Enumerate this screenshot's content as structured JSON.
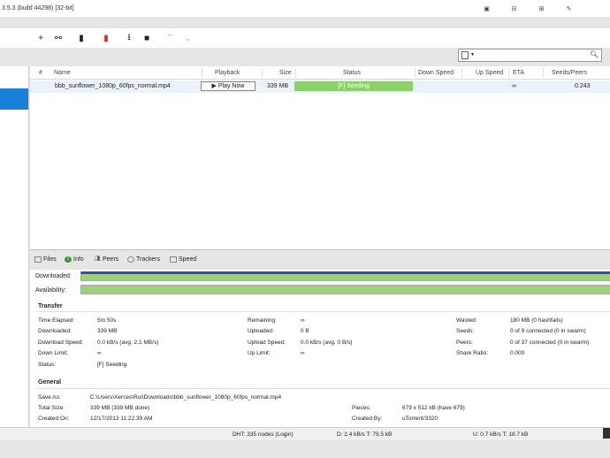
{
  "window": {
    "title": "3.5.3  (build 44298) [32-bit]"
  },
  "toolbar": {
    "add": "+",
    "add_link": "⚯",
    "create": "▮",
    "remove": "▮",
    "download": "⭳",
    "stop": "■",
    "up": "⌃",
    "down": "⌄"
  },
  "search": {
    "placeholder": "",
    "dropdown": "▾",
    "icon": "search-icon"
  },
  "columns": {
    "num": "#",
    "name": "Name",
    "playback": "Playback",
    "size": "Size",
    "status": "Status",
    "down_speed": "Down Speed",
    "up_speed": "Up Speed",
    "eta": "ETA",
    "seeds_peers": "Seeds/Peers"
  },
  "torrents": [
    {
      "name": "bbb_sunflower_1080p_60fps_normal.mp4",
      "playback": "▶ Play Now",
      "size": "339 MB",
      "status": "[F] Seeding",
      "eta": "∞",
      "seeds_peers": "0.243"
    }
  ],
  "tabs": [
    "Files",
    "Info",
    "Peers",
    "Trackers",
    "Speed"
  ],
  "bars": {
    "downloaded": "Downloaded:",
    "availability": "Availability:"
  },
  "transfer": {
    "heading": "Transfer",
    "col1": [
      {
        "label": "Time Elapsed:",
        "value": "5m 50s"
      },
      {
        "label": "Downloaded:",
        "value": "339 MB"
      },
      {
        "label": "Download Speed:",
        "value": "0.0 kB/s (avg. 2.1 MB/s)"
      },
      {
        "label": "Down Limit:",
        "value": "∞"
      },
      {
        "label": "Status:",
        "value": "[F] Seeding"
      }
    ],
    "col2": [
      {
        "label": "Remaining:",
        "value": "∞"
      },
      {
        "label": "Uploaded:",
        "value": "0 B"
      },
      {
        "label": "Upload Speed:",
        "value": "0.0 kB/s (avg. 0 B/s)"
      },
      {
        "label": "Up Limit:",
        "value": "∞"
      }
    ],
    "col3": [
      {
        "label": "Wasted:",
        "value": "180 MB (0 hashfails)"
      },
      {
        "label": "Seeds:",
        "value": "0 of 9 connected (0 in swarm)"
      },
      {
        "label": "Peers:",
        "value": "0 of 37 connected (0 in swarm)"
      },
      {
        "label": "Share Ratio:",
        "value": "0.000"
      }
    ]
  },
  "general": {
    "heading": "General",
    "save_as": {
      "label": "Save As:",
      "value": "C:\\Users\\Xerces\\Rui\\Downloads\\bbb_sunflower_1080p_60fps_normal.mp4"
    },
    "total_size": {
      "label": "Total Size:",
      "value": "339 MB (339 MB done)"
    },
    "created_on": {
      "label": "Created On:",
      "value": "12/17/2013 11:22:39 AM"
    },
    "pieces": {
      "label": "Pieces:",
      "value": "679 x 512 kB (have 679)"
    },
    "created_by": {
      "label": "Created By:",
      "value": "uTorrent/3320"
    }
  },
  "statusbar": {
    "dht": "DHT: 335 nodes (Login)",
    "download": "D: 2.4 kB/s T: 79.5 kB",
    "upload": "U: 0.7 kB/s T: 18.7 kB"
  }
}
